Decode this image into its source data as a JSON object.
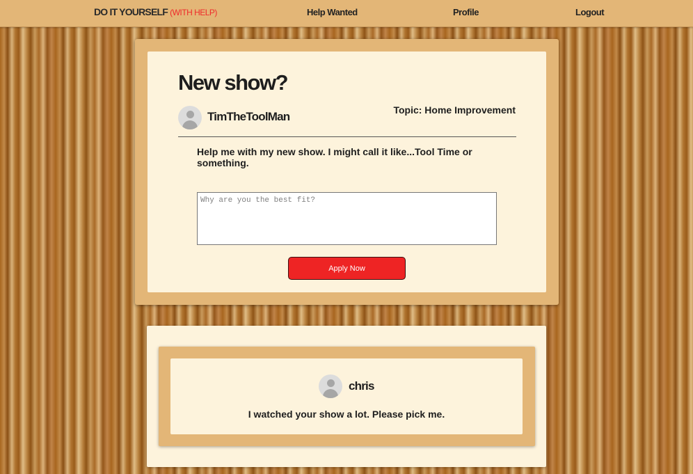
{
  "nav": {
    "brand": "DO IT YOURSELF",
    "brand_accent": "(WITH HELP)",
    "links": [
      {
        "label": "Help Wanted"
      },
      {
        "label": "Profile"
      },
      {
        "label": "Logout"
      }
    ]
  },
  "post": {
    "title": "New show?",
    "author": "TimTheToolMan",
    "topic": "Topic: Home Improvement",
    "body": "Help me with my new show. I might call it like...Tool Time or something.",
    "application_placeholder": "Why are you the best fit?",
    "application_value": "",
    "apply_label": "Apply Now"
  },
  "replies": [
    {
      "author": "chris",
      "message": "I watched your show a lot. Please pick me."
    }
  ],
  "colors": {
    "nav_bg": "#e3b677",
    "card_bg": "#fdf3dc",
    "accent_red": "#ee2424"
  },
  "icons": {
    "avatar": "user-avatar-icon"
  }
}
